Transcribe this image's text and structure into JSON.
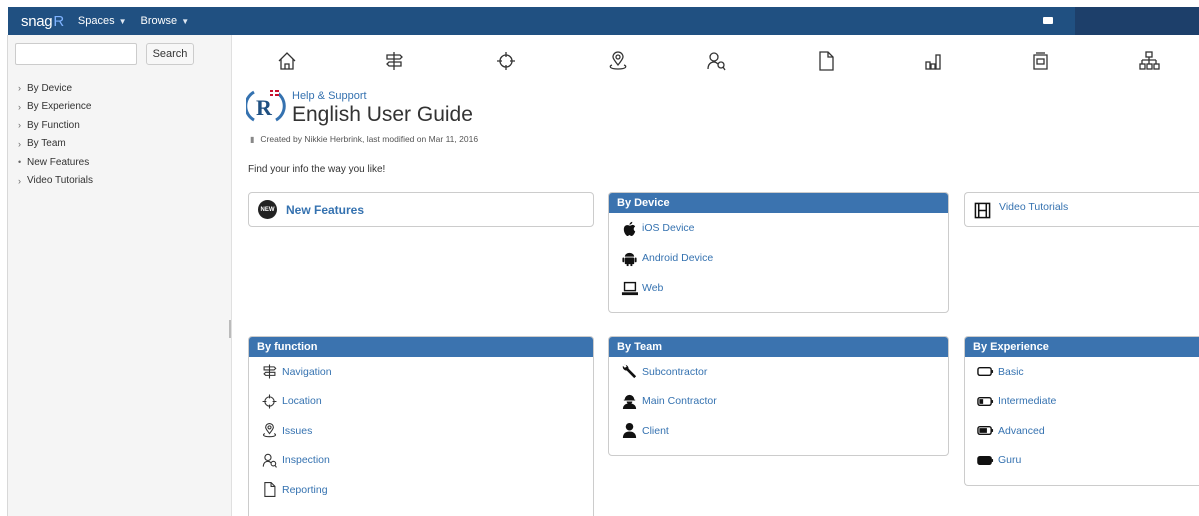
{
  "topbar": {
    "logo_text": "snag",
    "logo_accent": "R",
    "menus": [
      {
        "label": "Spaces"
      },
      {
        "label": "Browse"
      }
    ]
  },
  "sidebar": {
    "search_placeholder": "",
    "search_button": "Search",
    "tree": [
      {
        "toggle": "›",
        "label": "By Device"
      },
      {
        "toggle": "›",
        "label": "By Experience"
      },
      {
        "toggle": "›",
        "label": "By Function"
      },
      {
        "toggle": "›",
        "label": "By Team"
      },
      {
        "toggle": "•",
        "label": "New Features"
      },
      {
        "toggle": "›",
        "label": "Video Tutorials"
      }
    ]
  },
  "icon_row": [
    "home-icon",
    "signpost-icon",
    "crosshair-icon",
    "location-pin-icon",
    "inspection-icon",
    "document-icon",
    "bar-chart-icon",
    "folder-icon",
    "sitemap-icon"
  ],
  "page": {
    "breadcrumb": "Help & Support",
    "title": "English User Guide",
    "meta": "Created by Nikkie Herbrink, last modified on Mar 11, 2016",
    "intro": "Find your info the way you like!"
  },
  "panels": {
    "new_features": {
      "label": "New Features",
      "badge": "NEW"
    },
    "by_device": {
      "title": "By Device",
      "links": [
        {
          "label": "iOS Device",
          "icon": "apple-icon"
        },
        {
          "label": "Android Device",
          "icon": "android-icon"
        },
        {
          "label": "Web",
          "icon": "laptop-icon"
        }
      ]
    },
    "video_tutorials": {
      "label": "Video Tutorials"
    },
    "by_function": {
      "title": "By function",
      "links": [
        {
          "label": "Navigation",
          "icon": "signpost-icon"
        },
        {
          "label": "Location",
          "icon": "crosshair-icon"
        },
        {
          "label": "Issues",
          "icon": "location-pin-icon"
        },
        {
          "label": "Inspection",
          "icon": "inspection-icon"
        },
        {
          "label": "Reporting",
          "icon": "document-icon"
        }
      ]
    },
    "by_team": {
      "title": "By Team",
      "links": [
        {
          "label": "Subcontractor",
          "icon": "wrench-icon"
        },
        {
          "label": "Main Contractor",
          "icon": "worker-icon"
        },
        {
          "label": "Client",
          "icon": "user-icon"
        }
      ]
    },
    "by_experience": {
      "title": "By Experience",
      "links": [
        {
          "label": "Basic",
          "icon": "battery-empty-icon",
          "level": 0
        },
        {
          "label": "Intermediate",
          "icon": "battery-low-icon",
          "level": 0.33
        },
        {
          "label": "Advanced",
          "icon": "battery-mid-icon",
          "level": 0.66
        },
        {
          "label": "Guru",
          "icon": "battery-full-icon",
          "level": 1
        }
      ]
    }
  },
  "colors": {
    "topbar": "#205081",
    "panel_header": "#3b73af",
    "link": "#3572b0"
  }
}
